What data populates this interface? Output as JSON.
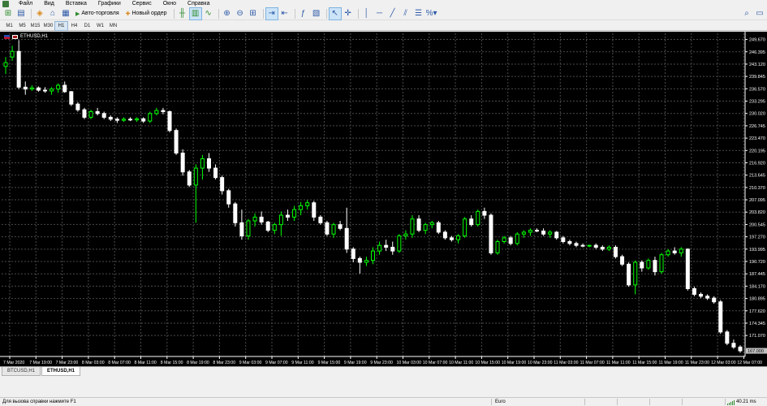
{
  "menu": [
    "Файл",
    "Вид",
    "Вставка",
    "Графики",
    "Сервис",
    "Окно",
    "Справка"
  ],
  "toolbar": {
    "autotrading_label": "Авто-торговля",
    "new_order_label": "Новый ордер"
  },
  "timeframes": [
    "M1",
    "M5",
    "M15",
    "M30",
    "H1",
    "H4",
    "D1",
    "W1",
    "MN"
  ],
  "active_timeframe": "H1",
  "chart": {
    "symbol_label": "ETHUSD,H1",
    "current_price": "167.000",
    "bull_color": "#00ff00",
    "bear_color": "#ffffff",
    "grid_color": "#4a4a4a",
    "price_ticks": [
      "249.670",
      "246.395",
      "243.120",
      "239.845",
      "236.570",
      "233.295",
      "230.020",
      "226.745",
      "223.470",
      "220.195",
      "216.920",
      "213.645",
      "210.370",
      "207.095",
      "203.820",
      "200.545",
      "197.270",
      "193.995",
      "190.720",
      "187.445",
      "184.170",
      "180.895",
      "177.620",
      "174.345",
      "171.070"
    ],
    "time_ticks": [
      "7 Mar 2020",
      "7 Mar 19:00",
      "7 Mar 23:00",
      "8 Mar 03:00",
      "8 Mar 07:00",
      "8 Mar 11:00",
      "8 Mar 15:00",
      "8 Mar 19:00",
      "8 Mar 23:00",
      "9 Mar 03:00",
      "9 Mar 07:00",
      "9 Mar 11:00",
      "9 Mar 15:00",
      "9 Mar 19:00",
      "9 Mar 23:00",
      "10 Mar 03:00",
      "10 Mar 07:00",
      "10 Mar 11:00",
      "10 Mar 15:00",
      "10 Mar 19:00",
      "10 Mar 23:00",
      "11 Mar 03:00",
      "11 Mar 07:00",
      "11 Mar 11:00",
      "11 Mar 15:00",
      "11 Mar 19:00",
      "11 Mar 23:00",
      "12 Mar 03:00",
      "12 Mar 07:00"
    ],
    "ohlc": [
      [
        242.5,
        245.0,
        240.5,
        243.5
      ],
      [
        245.0,
        248.0,
        244.0,
        246.5
      ],
      [
        246.5,
        249.5,
        236.5,
        237.0
      ],
      [
        237.0,
        238.5,
        235.0,
        236.5
      ],
      [
        236.5,
        237.5,
        236.0,
        236.8
      ],
      [
        236.8,
        237.2,
        235.8,
        236.2
      ],
      [
        236.2,
        237.0,
        235.5,
        236.0
      ],
      [
        236.0,
        237.0,
        235.0,
        236.5
      ],
      [
        236.5,
        238.0,
        235.5,
        237.5
      ],
      [
        237.5,
        238.5,
        235.5,
        235.8
      ],
      [
        235.8,
        236.0,
        232.0,
        232.5
      ],
      [
        232.5,
        233.0,
        230.5,
        231.0
      ],
      [
        231.0,
        231.5,
        228.5,
        229.0
      ],
      [
        229.0,
        231.0,
        228.5,
        230.5
      ],
      [
        230.5,
        231.5,
        229.5,
        230.0
      ],
      [
        230.0,
        230.5,
        228.5,
        229.0
      ],
      [
        229.0,
        229.5,
        228.0,
        228.5
      ],
      [
        228.5,
        229.0,
        227.5,
        228.2
      ],
      [
        228.2,
        229.0,
        227.8,
        228.5
      ],
      [
        228.5,
        229.0,
        228.0,
        228.3
      ],
      [
        228.3,
        229.0,
        227.8,
        228.6
      ],
      [
        228.6,
        229.0,
        227.5,
        228.0
      ],
      [
        228.0,
        230.5,
        227.5,
        230.0
      ],
      [
        230.0,
        231.5,
        229.5,
        230.8
      ],
      [
        230.8,
        231.5,
        229.8,
        230.5
      ],
      [
        230.5,
        230.8,
        225.0,
        225.5
      ],
      [
        225.5,
        226.0,
        219.0,
        219.5
      ],
      [
        219.5,
        220.5,
        213.5,
        214.5
      ],
      [
        214.5,
        215.0,
        210.5,
        211.0
      ],
      [
        211.0,
        216.5,
        201.0,
        215.5
      ],
      [
        215.5,
        219.0,
        212.5,
        218.0
      ],
      [
        218.0,
        219.5,
        214.5,
        215.5
      ],
      [
        215.5,
        216.5,
        212.5,
        213.0
      ],
      [
        213.0,
        213.5,
        208.5,
        209.5
      ],
      [
        209.5,
        210.0,
        205.0,
        206.0
      ],
      [
        206.0,
        206.5,
        200.0,
        201.0
      ],
      [
        201.0,
        204.5,
        196.5,
        197.5
      ],
      [
        197.5,
        202.0,
        196.5,
        201.5
      ],
      [
        201.5,
        203.5,
        200.0,
        202.5
      ],
      [
        202.5,
        204.0,
        200.5,
        201.2
      ],
      [
        201.2,
        201.5,
        198.5,
        199.0
      ],
      [
        199.0,
        201.0,
        198.0,
        200.5
      ],
      [
        200.5,
        204.0,
        197.5,
        203.0
      ],
      [
        203.0,
        204.5,
        201.5,
        202.5
      ],
      [
        202.5,
        205.5,
        201.5,
        204.5
      ],
      [
        204.5,
        206.5,
        203.0,
        205.5
      ],
      [
        205.5,
        207.0,
        204.5,
        206.3
      ],
      [
        206.3,
        206.8,
        201.5,
        202.5
      ],
      [
        202.5,
        203.0,
        200.5,
        201.0
      ],
      [
        201.0,
        201.5,
        197.5,
        198.0
      ],
      [
        198.0,
        201.0,
        197.0,
        200.5
      ],
      [
        200.5,
        201.5,
        199.0,
        199.5
      ],
      [
        199.5,
        205.0,
        193.0,
        194.0
      ],
      [
        194.0,
        194.5,
        190.5,
        191.5
      ],
      [
        191.5,
        192.0,
        187.5,
        190.5
      ],
      [
        190.5,
        192.0,
        189.5,
        191.0
      ],
      [
        191.0,
        194.5,
        190.0,
        193.5
      ],
      [
        193.5,
        196.0,
        192.5,
        195.0
      ],
      [
        195.0,
        196.5,
        193.5,
        194.5
      ],
      [
        194.5,
        196.0,
        192.5,
        193.5
      ],
      [
        193.5,
        198.0,
        193.0,
        197.5
      ],
      [
        197.5,
        199.0,
        196.5,
        198.0
      ],
      [
        198.0,
        203.0,
        197.0,
        202.0
      ],
      [
        202.0,
        203.0,
        198.5,
        199.0
      ],
      [
        199.0,
        201.0,
        198.0,
        200.5
      ],
      [
        200.5,
        201.5,
        199.5,
        201.0
      ],
      [
        201.0,
        201.5,
        198.0,
        198.5
      ],
      [
        198.5,
        199.0,
        196.5,
        197.0
      ],
      [
        197.0,
        197.5,
        196.0,
        196.5
      ],
      [
        196.5,
        198.0,
        195.5,
        197.5
      ],
      [
        197.5,
        202.5,
        197.0,
        202.0
      ],
      [
        202.0,
        203.0,
        200.0,
        200.5
      ],
      [
        200.5,
        204.5,
        200.0,
        204.0
      ],
      [
        204.0,
        205.0,
        202.0,
        203.0
      ],
      [
        203.0,
        203.5,
        192.5,
        193.0
      ],
      [
        193.0,
        196.5,
        192.5,
        196.0
      ],
      [
        196.0,
        197.5,
        195.5,
        197.0
      ],
      [
        197.0,
        197.5,
        195.0,
        195.5
      ],
      [
        195.5,
        198.5,
        195.0,
        198.0
      ],
      [
        198.0,
        199.0,
        197.0,
        198.5
      ],
      [
        198.5,
        199.5,
        197.5,
        199.0
      ],
      [
        199.0,
        199.5,
        198.5,
        198.8
      ],
      [
        198.8,
        199.5,
        197.5,
        198.0
      ],
      [
        198.0,
        199.0,
        197.0,
        198.5
      ],
      [
        198.5,
        198.8,
        196.5,
        197.0
      ],
      [
        197.0,
        197.5,
        195.5,
        196.0
      ],
      [
        196.0,
        196.5,
        195.0,
        195.5
      ],
      [
        195.5,
        196.0,
        194.5,
        195.0
      ],
      [
        195.0,
        195.5,
        194.5,
        194.8
      ],
      [
        194.8,
        195.2,
        194.5,
        195.0
      ],
      [
        195.0,
        195.5,
        194.0,
        194.5
      ],
      [
        194.5,
        195.0,
        193.5,
        194.0
      ],
      [
        194.0,
        195.0,
        193.5,
        194.5
      ],
      [
        194.5,
        195.0,
        191.5,
        192.0
      ],
      [
        192.0,
        192.5,
        189.5,
        190.0
      ],
      [
        190.0,
        190.5,
        184.0,
        184.5
      ],
      [
        184.5,
        191.0,
        182.0,
        190.5
      ],
      [
        190.5,
        191.0,
        188.0,
        189.0
      ],
      [
        189.0,
        191.5,
        188.5,
        191.0
      ],
      [
        191.0,
        192.0,
        187.0,
        188.0
      ],
      [
        188.0,
        193.0,
        187.5,
        192.5
      ],
      [
        192.5,
        194.0,
        192.0,
        193.5
      ],
      [
        193.5,
        194.5,
        192.5,
        193.0
      ],
      [
        193.0,
        194.5,
        192.0,
        194.0
      ],
      [
        194.0,
        194.2,
        183.0,
        183.5
      ],
      [
        183.5,
        184.0,
        181.5,
        182.0
      ],
      [
        182.0,
        182.5,
        181.0,
        181.5
      ],
      [
        181.5,
        182.0,
        180.5,
        181.0
      ],
      [
        181.0,
        181.5,
        179.5,
        180.0
      ],
      [
        180.0,
        180.5,
        171.5,
        172.0
      ],
      [
        172.0,
        172.5,
        168.5,
        169.0
      ],
      [
        169.0,
        170.0,
        167.5,
        168.0
      ],
      [
        168.0,
        168.5,
        166.5,
        167.0
      ]
    ]
  },
  "tabs": [
    {
      "label": "BTCUSD,H1",
      "active": false
    },
    {
      "label": "ETHUSD,H1",
      "active": true
    }
  ],
  "status": {
    "help": "Для вызова справки нажмите F1",
    "profile": "Euro",
    "ping": "40.21 ms"
  }
}
